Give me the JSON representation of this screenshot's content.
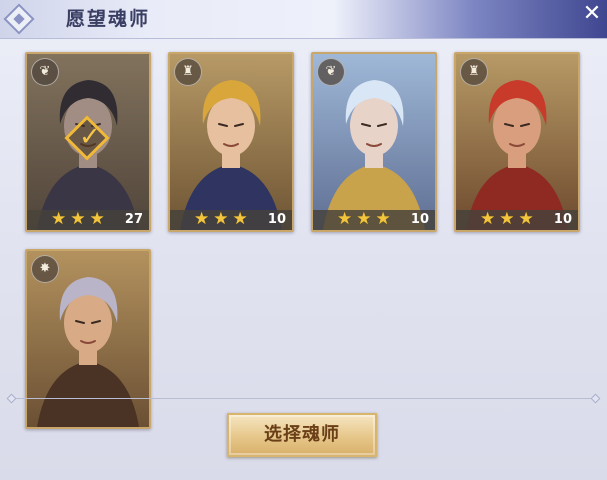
{
  "window": {
    "title": "愿望魂师",
    "close_glyph": "✕"
  },
  "soul_masters": [
    {
      "class_icon": "wing-icon",
      "class_glyph": "❦",
      "stars": 3,
      "stars_text": "★★★",
      "level": "27",
      "selected": true,
      "colors": {
        "bg1": "#a8906a",
        "bg2": "#5c4a36",
        "hair": "#2a2428",
        "skin": "#d9b8a6",
        "cloth": "#3b3345"
      }
    },
    {
      "class_icon": "bow-icon",
      "class_glyph": "♜",
      "stars": 3,
      "stars_text": "★★★",
      "level": "10",
      "selected": false,
      "colors": {
        "bg1": "#b79a66",
        "bg2": "#6e5434",
        "hair": "#d9a63c",
        "skin": "#e7c0a0",
        "cloth": "#2f3560"
      }
    },
    {
      "class_icon": "wing-icon",
      "class_glyph": "❦",
      "stars": 3,
      "stars_text": "★★★",
      "level": "10",
      "selected": false,
      "colors": {
        "bg1": "#9fb8d8",
        "bg2": "#5f6f93",
        "hair": "#d8e6f6",
        "skin": "#e8d3c8",
        "cloth": "#c9a24c"
      }
    },
    {
      "class_icon": "bow-icon",
      "class_glyph": "♜",
      "stars": 3,
      "stars_text": "★★★",
      "level": "10",
      "selected": false,
      "colors": {
        "bg1": "#b79a66",
        "bg2": "#6e4a2e",
        "hair": "#c83a2a",
        "skin": "#d99e7e",
        "cloth": "#8e2a22"
      }
    },
    {
      "class_icon": "flame-icon",
      "class_glyph": "✸",
      "stars": 0,
      "stars_text": "",
      "level": "",
      "selected": false,
      "colors": {
        "bg1": "#b3925e",
        "bg2": "#6b5034",
        "hair": "#b9b4c8",
        "skin": "#d8ab86",
        "cloth": "#4a3324"
      }
    }
  ],
  "action": {
    "select_label": "选择魂师"
  },
  "colors": {
    "accent_gold": "#f2c53c",
    "button_text": "#6a3f18",
    "title_text": "#3a3e63"
  }
}
